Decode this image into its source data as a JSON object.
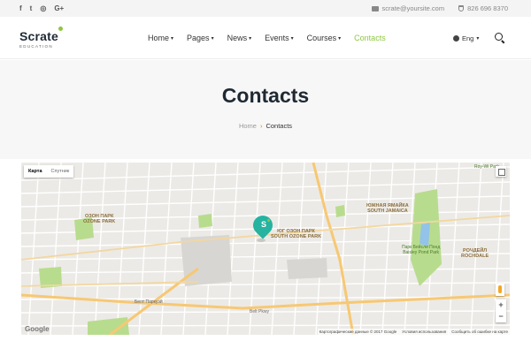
{
  "topbar": {
    "social": [
      "f",
      "t",
      "◎",
      "G+"
    ],
    "email": "scrate@yoursite.com",
    "phone": "826 696 8370"
  },
  "logo": {
    "name": "Scrate",
    "tagline": "EDUCATION"
  },
  "nav": {
    "items": [
      {
        "label": "Home",
        "dropdown": true
      },
      {
        "label": "Pages",
        "dropdown": true
      },
      {
        "label": "News",
        "dropdown": true
      },
      {
        "label": "Events",
        "dropdown": true
      },
      {
        "label": "Courses",
        "dropdown": true
      },
      {
        "label": "Contacts",
        "dropdown": false,
        "active": true
      }
    ],
    "language": "Eng"
  },
  "page": {
    "title": "Contacts"
  },
  "breadcrumb": {
    "home": "Home",
    "separator": "›",
    "current": "Contacts"
  },
  "map": {
    "type_options": [
      "Карта",
      "Спутник"
    ],
    "labels": {
      "ozone_park_ru": "ОЗОН ПАРК",
      "ozone_park_en": "OZONE PARK",
      "south_ozone_ru": "ЮГ ОЗОН ПАРК",
      "south_ozone_en": "SOUTH OZONE PARK",
      "south_jamaica_ru": "ЮЖНАЯ ЯМАЙКА",
      "south_jamaica_en": "SOUTH JAMAICA",
      "baisley_ru": "Парк Бейсли Понд",
      "baisley_en": "Baisley Pond Park",
      "rochdale_ru": "РОЧДЕЙЛ",
      "rochdale_en": "ROCHDALE",
      "roy_wilkins": "Roy-Wi Park",
      "belt_parkway": "Белт Паркуэй",
      "belt_pkwy": "Belt Pkwy"
    },
    "zoom_in": "+",
    "zoom_out": "−",
    "google": "Google",
    "attribution": [
      "Картографические данные © 2017 Google",
      "Условия использования",
      "Сообщить об ошибке на карте"
    ],
    "colors": {
      "road_major": "#f7c873",
      "park": "#b8dc8e",
      "water": "#93c3e8",
      "marker": "#26b3a0"
    }
  },
  "colors": {
    "accent": "#8dc63f",
    "crumb_sep": "#f2a21a"
  }
}
